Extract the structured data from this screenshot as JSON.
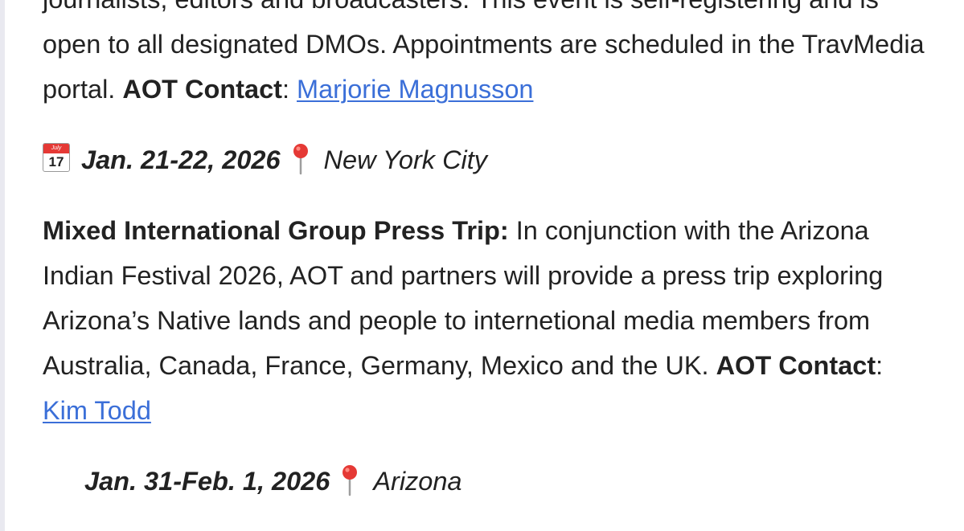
{
  "entry_1": {
    "description_line_top": "journalists, editors and broadcasters. This event is self-registering and is",
    "description": "open to all designated DMOs. Appointments are scheduled in the TravMedia portal.",
    "contact_label": "AOT Contact",
    "contact_colon": ":",
    "contact_name": "Marjorie Magnusson",
    "calendar_icon_month": "July",
    "calendar_icon_day": "17",
    "date": "Jan. 21-22, 2026",
    "location": "New York City"
  },
  "entry_2": {
    "title": "Mixed International Group Press Trip:",
    "description": "In conjunction with the Arizona Indian Festival 2026, AOT and partners will provide a press trip exploring Arizona’s Native lands and people to internetional media members from Australia, Canada, France, Germany, Mexico and the UK.",
    "contact_label": "AOT Contact",
    "contact_colon": ":",
    "contact_name": "Kim Todd",
    "date": "Jan. 31-Feb. 1, 2026",
    "location": "Arizona"
  },
  "icons": {
    "calendar": "calendar-icon",
    "pin": "round-pushpin-icon"
  },
  "colors": {
    "text": "#222222",
    "link": "#3b6fd8",
    "pin_red": "#e53935"
  }
}
